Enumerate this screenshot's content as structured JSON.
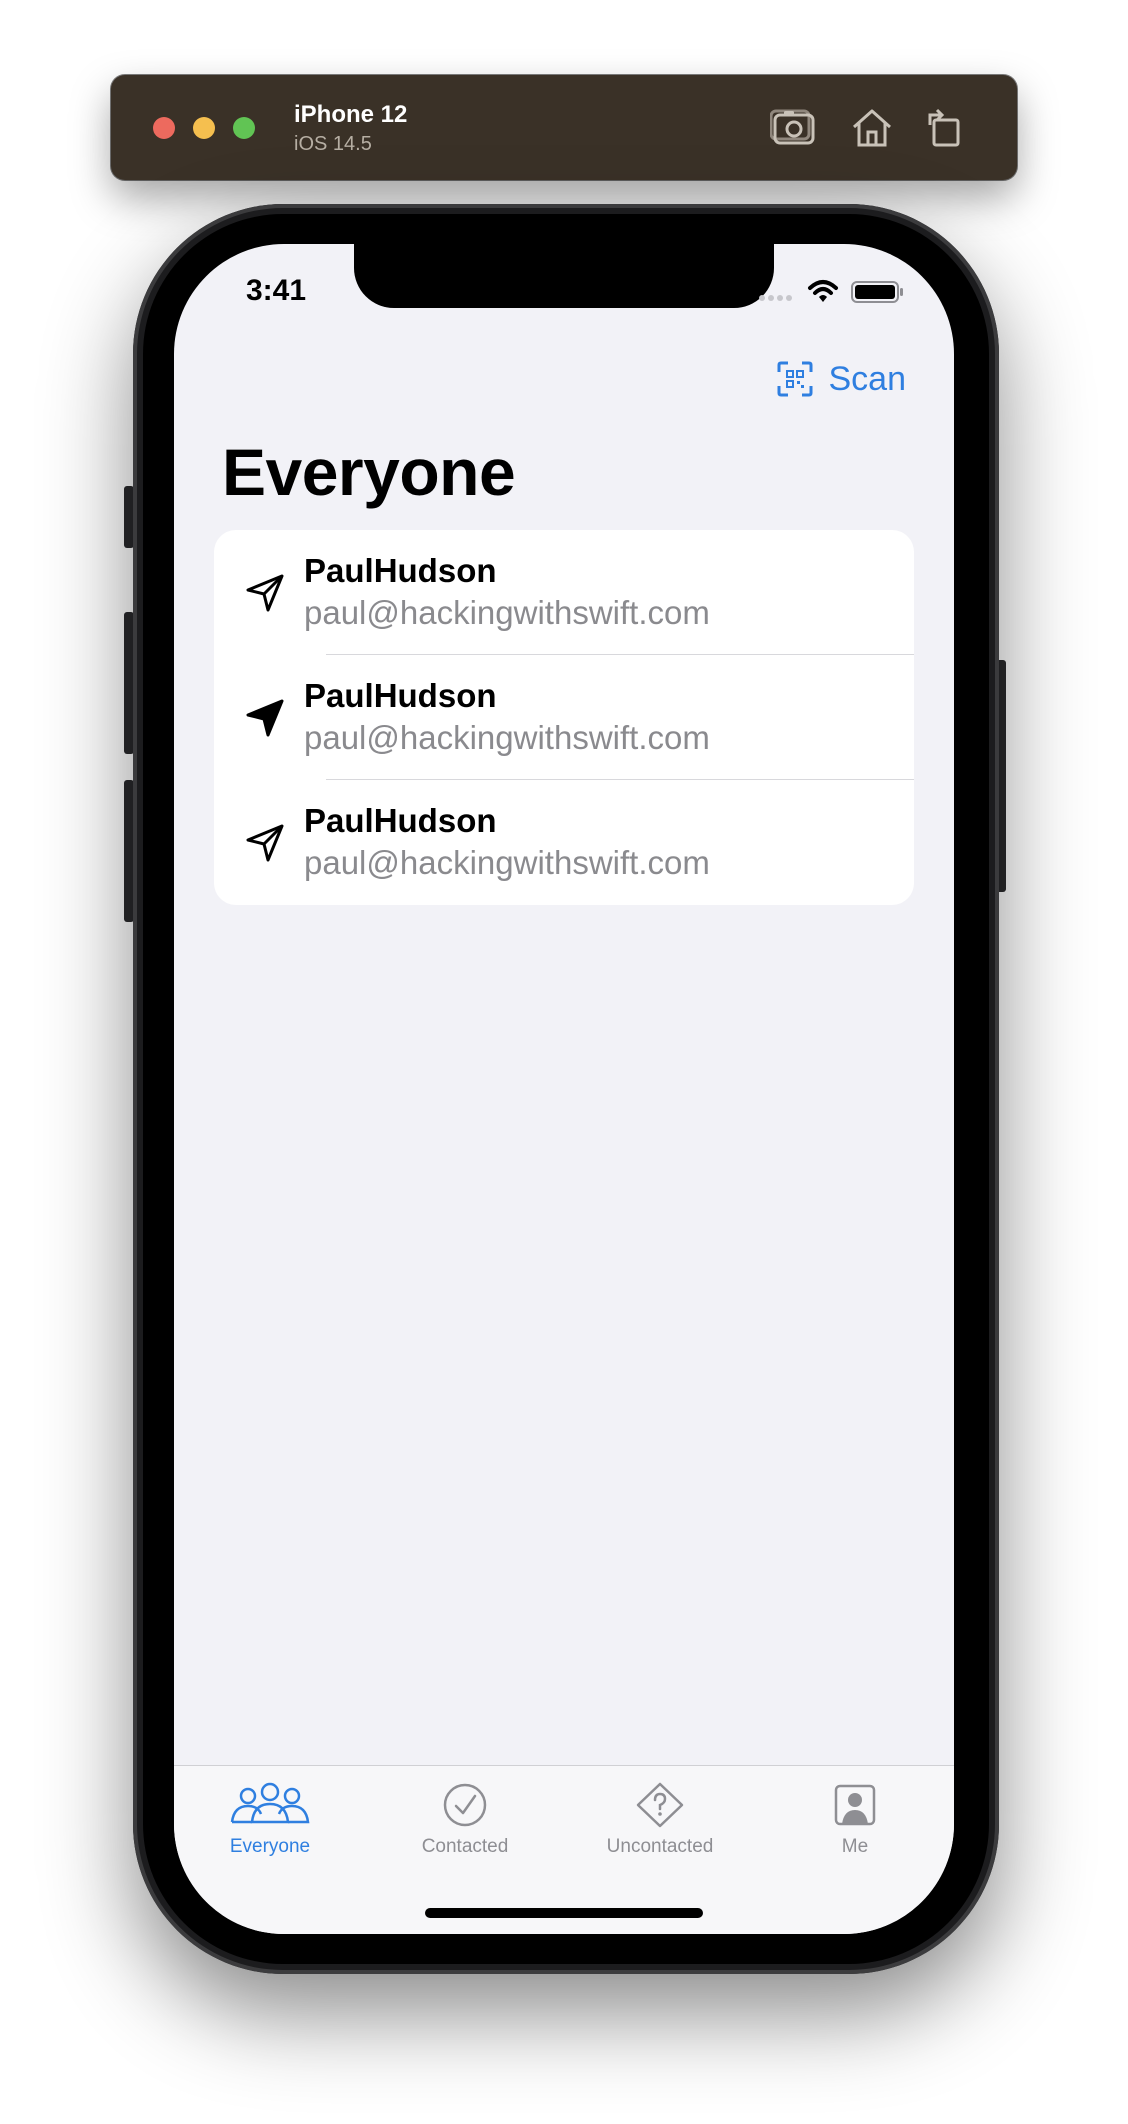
{
  "simulator": {
    "device_name": "iPhone 12",
    "os_version": "iOS 14.5",
    "buttons": [
      "screenshot-icon",
      "home-icon",
      "rotate-icon"
    ]
  },
  "status_bar": {
    "time": "3:41"
  },
  "nav": {
    "scan_label": "Scan",
    "title": "Everyone"
  },
  "contacts": [
    {
      "name": "PaulHudson",
      "email": "paul@hackingwithswift.com",
      "icon": "paperplane-outline-icon"
    },
    {
      "name": "PaulHudson",
      "email": "paul@hackingwithswift.com",
      "icon": "paperplane-filled-icon"
    },
    {
      "name": "PaulHudson",
      "email": "paul@hackingwithswift.com",
      "icon": "paperplane-outline-icon"
    }
  ],
  "tabs": [
    {
      "label": "Everyone",
      "icon": "people-icon",
      "selected": true
    },
    {
      "label": "Contacted",
      "icon": "checkmark-circle-icon",
      "selected": false
    },
    {
      "label": "Uncontacted",
      "icon": "questionmark-diamond-icon",
      "selected": false
    },
    {
      "label": "Me",
      "icon": "person-square-icon",
      "selected": false
    }
  ],
  "colors": {
    "accent": "#2f7fe0",
    "background": "#f2f2f7",
    "secondary_text": "#8a8a8e",
    "toolbar": "#3a3127"
  }
}
